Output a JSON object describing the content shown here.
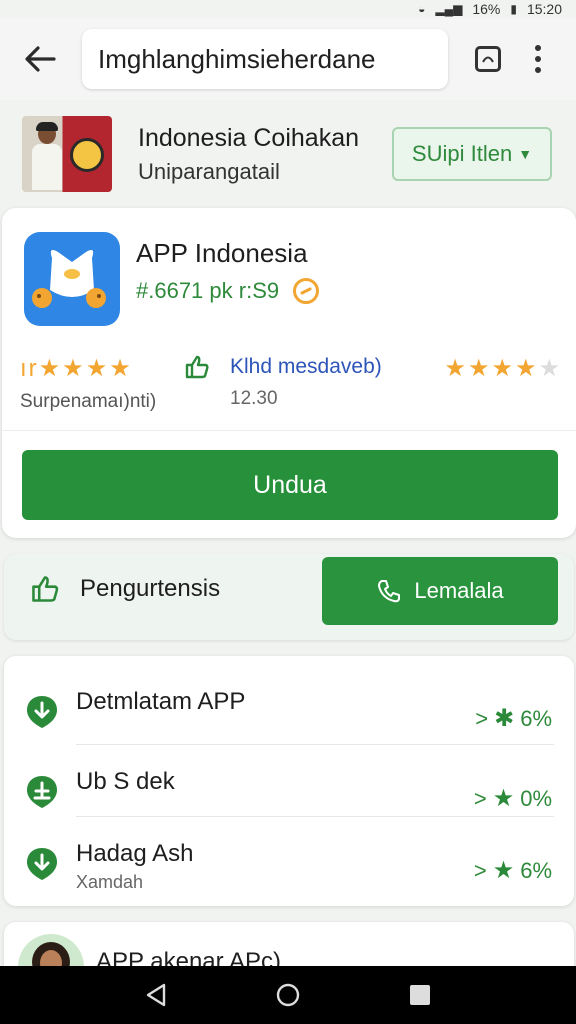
{
  "status_bar": {
    "battery": "16%",
    "time": "15:20"
  },
  "top_bar": {
    "url": "Imghlanghimsieherdane"
  },
  "publisher": {
    "title": "Indonesia Coihakan",
    "subtitle": "Uniparangatail",
    "select_label": "SUipi Itlen"
  },
  "app": {
    "name": "APP Indonesia",
    "meta": "#.6671 pk r:S9",
    "stat1": {
      "stars": "ır★★★★",
      "label": "Surpenamaı)nti)"
    },
    "stat2": {
      "label": "Klhd mesdaveb)",
      "value": "12.30"
    },
    "stat3": {
      "on": "★★★★",
      "off": "★"
    },
    "download_label": "Undua"
  },
  "actions": {
    "left_label": "Pengurtensis",
    "button_label": "Lemalala"
  },
  "list": [
    {
      "title": "Detmlatam APP",
      "subtitle": "",
      "value": "6%"
    },
    {
      "title": "Ub S dek",
      "subtitle": "",
      "value": "0%"
    },
    {
      "title": "Hadag Ash",
      "subtitle": "Xamdah",
      "value": "6%"
    }
  ],
  "bottom_card": {
    "title": "APP akenar APc)"
  },
  "colors": {
    "accent": "#27903a",
    "star": "#f2a531",
    "app_icon": "#2f86e4"
  }
}
